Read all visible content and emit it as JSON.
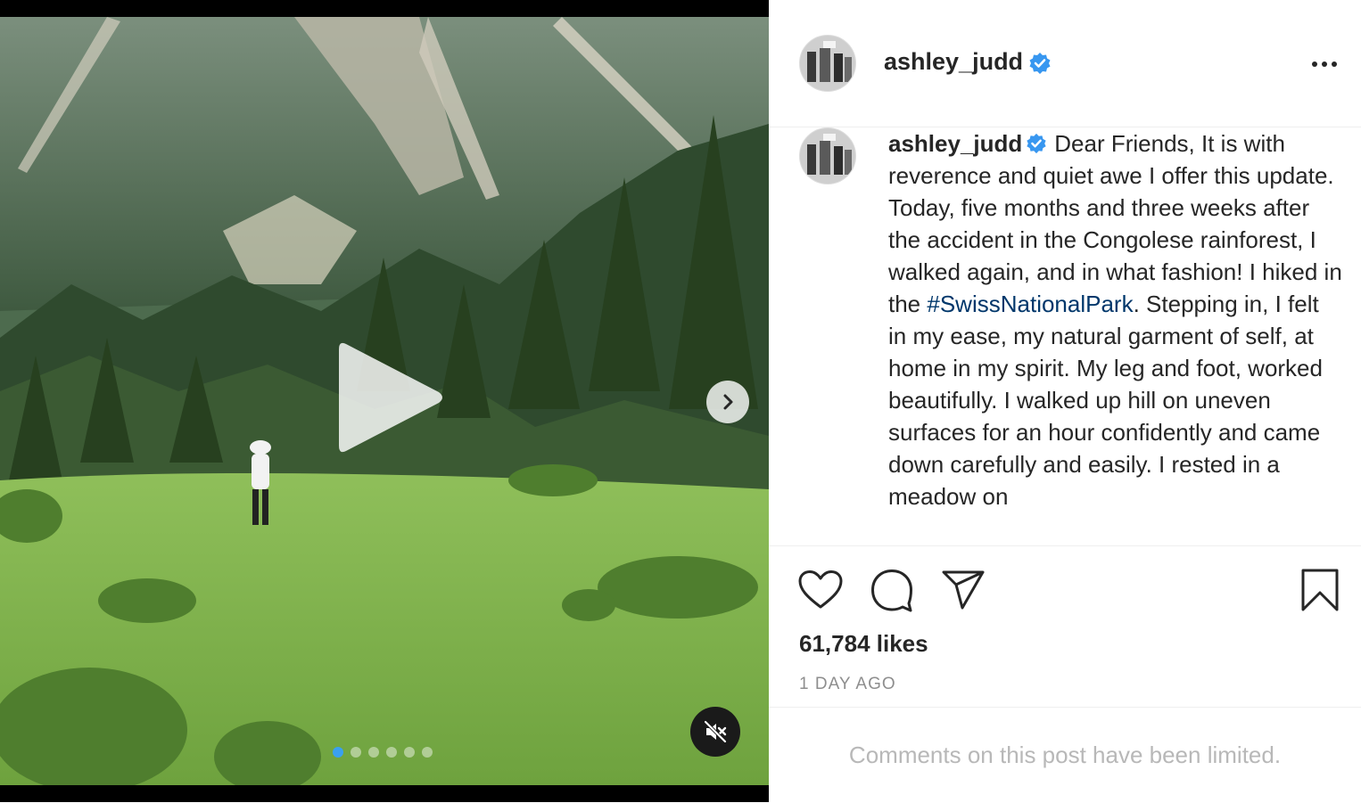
{
  "post": {
    "username": "ashley_judd",
    "verified": true,
    "caption_before_hashtag": "Dear Friends, It is with reverence and quiet awe I offer this update. Today, five months and three weeks after the accident in the Congolese rainforest, I walked again, and in what fashion! I hiked in the ",
    "hashtag": "#SwissNationalPark",
    "caption_after_hashtag": ". Stepping in, I felt in my ease, my natural garment of self, at home in my spirit. My leg and foot, worked beautifully. I walked up hill on uneven surfaces for an hour confidently and came down carefully and easily. I rested in a meadow on",
    "likes": "61,784 likes",
    "date": "1 DAY AGO",
    "comments_notice": "Comments on this post have been limited."
  },
  "media": {
    "carousel_slide_count": 6,
    "carousel_active_index": 0,
    "sound_muted": true
  },
  "colors": {
    "text": "#262626",
    "secondary_text": "#8e8e8e",
    "hashtag_link": "#00376b",
    "verified_badge": "#3897f0",
    "divider": "#efefef"
  },
  "icons": {
    "header": [
      "verified-badge-icon",
      "more-options-icon"
    ],
    "actions": [
      "heart-icon",
      "comment-icon",
      "share-icon",
      "bookmark-icon"
    ],
    "media": [
      "play-icon",
      "chevron-right-icon",
      "speaker-muted-icon"
    ]
  }
}
